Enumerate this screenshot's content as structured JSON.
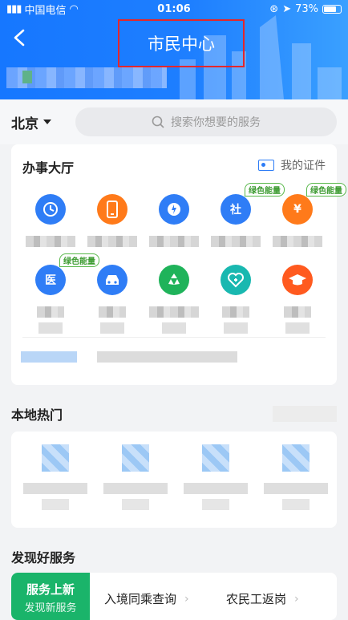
{
  "status_bar": {
    "carrier": "中国电信",
    "time": "01:06",
    "battery": "73%"
  },
  "header": {
    "title": "市民中心"
  },
  "search_row": {
    "city": "北京",
    "placeholder": "搜索你想要的服务"
  },
  "hall": {
    "title": "办事大厅",
    "my_cert": "我的证件",
    "services": [
      {
        "icon": "clock-icon",
        "color": "#2f7df6"
      },
      {
        "icon": "phone-icon",
        "color": "#ff7a1a"
      },
      {
        "icon": "fire-icon",
        "color": "#2f7df6"
      },
      {
        "icon": "social-security-icon",
        "color": "#2f7df6",
        "glyph": "社",
        "badge": "绿色能量"
      },
      {
        "icon": "housing-fund-icon",
        "color": "#ff7a1a",
        "glyph": "¥",
        "badge": "绿色能量"
      },
      {
        "icon": "medical-icon",
        "color": "#2f7df6",
        "glyph": "医",
        "badge": "绿色能量"
      },
      {
        "icon": "car-icon",
        "color": "#2f7df6"
      },
      {
        "icon": "recycle-icon",
        "color": "#1fb35a"
      },
      {
        "icon": "health-icon",
        "color": "#19b8b0"
      },
      {
        "icon": "education-icon",
        "color": "#ff5a1f"
      }
    ]
  },
  "local": {
    "title": "本地热门"
  },
  "discover": {
    "title": "发现好服务",
    "promo_line1": "服务上新",
    "promo_line2": "发现新服务",
    "items": [
      "入境同乘查询",
      "农民工返岗"
    ]
  }
}
